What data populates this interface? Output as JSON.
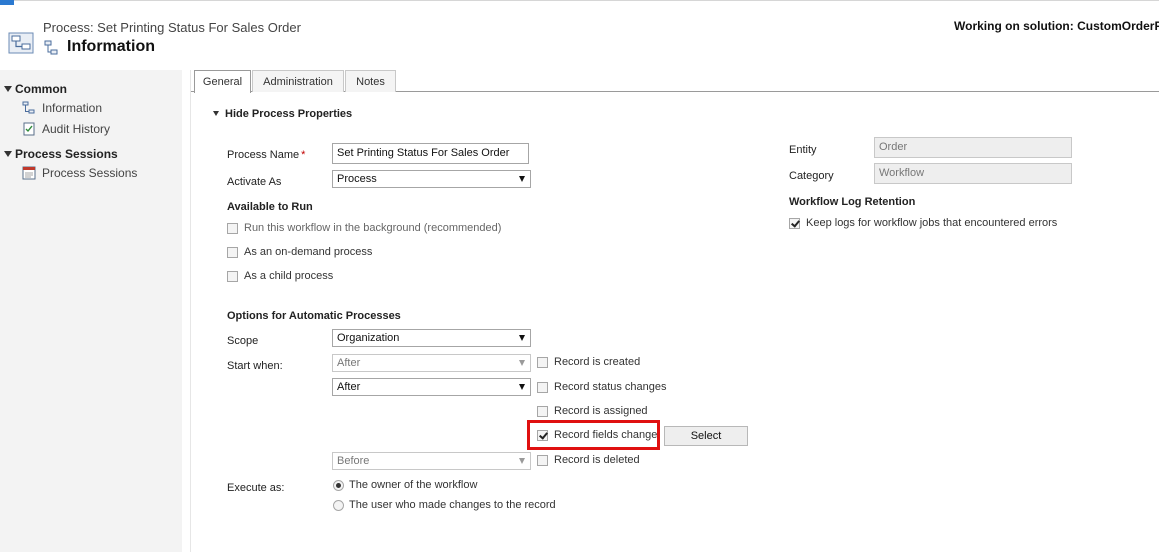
{
  "header": {
    "subtitle": "Process: Set Printing Status For Sales Order",
    "title": "Information",
    "solution": "Working on solution: CustomOrderPrint"
  },
  "sidebar": {
    "groups": [
      {
        "label": "Common",
        "items": [
          {
            "label": "Information",
            "icon": "process-icon"
          },
          {
            "label": "Audit History",
            "icon": "audit-icon"
          }
        ]
      },
      {
        "label": "Process Sessions",
        "items": [
          {
            "label": "Process Sessions",
            "icon": "sessions-icon"
          }
        ]
      }
    ]
  },
  "tabs": [
    "General",
    "Administration",
    "Notes"
  ],
  "section": {
    "toggle_label": "Hide Process Properties"
  },
  "form": {
    "process_name_label": "Process Name",
    "required_mark": "*",
    "process_name_value": "Set Printing Status For Sales Order",
    "activate_as_label": "Activate As",
    "activate_as_value": "Process",
    "available_to_run_heading": "Available to Run",
    "run_background_label": "Run this workflow in the background (recommended)",
    "on_demand_label": "As an on-demand process",
    "child_process_label": "As a child process",
    "options_heading": "Options for Automatic Processes",
    "scope_label": "Scope",
    "scope_value": "Organization",
    "start_when_label": "Start when:",
    "start_created_select": "After",
    "start_created_label": "Record is created",
    "start_status_select": "After",
    "start_status_label": "Record status changes",
    "start_assigned_label": "Record is assigned",
    "start_fields_label": "Record fields change",
    "select_button": "Select",
    "start_deleted_select": "Before",
    "start_deleted_label": "Record is deleted",
    "execute_as_label": "Execute as:",
    "execute_owner_label": "The owner of the workflow",
    "execute_user_label": "The user who made changes to the record",
    "entity_label": "Entity",
    "entity_value": "Order",
    "category_label": "Category",
    "category_value": "Workflow",
    "log_heading": "Workflow Log Retention",
    "log_keep_label": "Keep logs for workflow jobs that encountered errors"
  },
  "states": {
    "run_background": false,
    "on_demand": false,
    "child_process": false,
    "record_created": false,
    "record_status": false,
    "record_assigned": false,
    "record_fields": true,
    "record_deleted": false,
    "keep_logs": true,
    "execute_owner": true,
    "execute_user": false
  },
  "colors": {
    "accent": "#2b79d0",
    "highlight": "#e01010",
    "required": "#c00000"
  }
}
